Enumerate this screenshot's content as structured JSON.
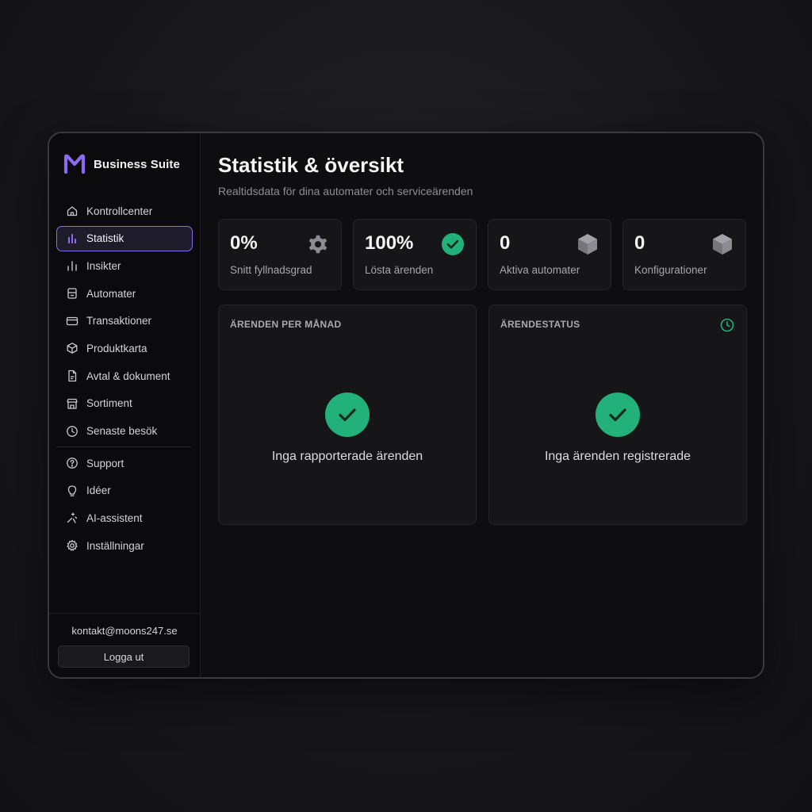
{
  "brand": {
    "name": "Business Suite",
    "logo_color": "#8b6cf0"
  },
  "sidebar": {
    "items": [
      {
        "label": "Kontrollcenter",
        "icon": "home-icon"
      },
      {
        "label": "Statistik",
        "icon": "bar-chart-icon",
        "active": true
      },
      {
        "label": "Insikter",
        "icon": "insights-icon"
      },
      {
        "label": "Automater",
        "icon": "vending-machine-icon"
      },
      {
        "label": "Transaktioner",
        "icon": "credit-card-icon"
      },
      {
        "label": "Produktkarta",
        "icon": "box-icon"
      },
      {
        "label": "Avtal & dokument",
        "icon": "document-icon"
      },
      {
        "label": "Sortiment",
        "icon": "store-icon"
      },
      {
        "label": "Senaste besök",
        "icon": "clock-icon"
      }
    ],
    "secondary_items": [
      {
        "label": "Support",
        "icon": "help-icon"
      },
      {
        "label": "Idéer",
        "icon": "lightbulb-icon"
      },
      {
        "label": "AI-assistent",
        "icon": "sparkle-icon"
      },
      {
        "label": "Inställningar",
        "icon": "gear-icon"
      }
    ],
    "footer": {
      "email": "kontakt@moons247.se",
      "logout_label": "Logga ut"
    }
  },
  "header": {
    "title": "Statistik & översikt",
    "subtitle": "Realtidsdata för dina automater och serviceärenden"
  },
  "stats": [
    {
      "value": "0%",
      "label": "Snitt fyllnadsgrad",
      "icon": "gear-icon"
    },
    {
      "value": "100%",
      "label": "Lösta ärenden",
      "icon": "check-circle-icon"
    },
    {
      "value": "0",
      "label": "Aktiva automater",
      "icon": "cube-icon"
    },
    {
      "value": "0",
      "label": "Konfigurationer",
      "icon": "cube-icon"
    }
  ],
  "panels": [
    {
      "title": "ÄRENDEN PER MÅNAD",
      "message": "Inga rapporterade ärenden"
    },
    {
      "title": "ÄRENDESTATUS",
      "message": "Inga ärenden registrerade",
      "corner_icon": "clock-icon"
    }
  ],
  "colors": {
    "accent": "#8b6cf0",
    "success": "#22b17a",
    "muted_icon": "#8c8c92"
  }
}
